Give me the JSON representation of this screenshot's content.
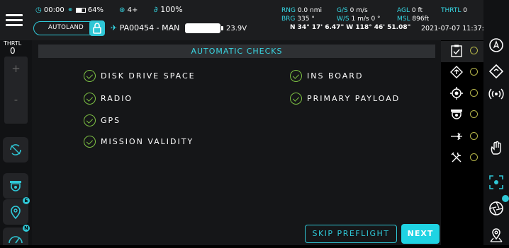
{
  "topbar": {
    "timer": "00:00",
    "battery_pct": "64%",
    "signal": "4+",
    "link": "100%",
    "autoland": "AUTOLAND",
    "aircraft": "PA00454 - MAN",
    "voltage": "23.9V",
    "rng_label": "RNG",
    "rng_val": "0.0 nmi",
    "gs_label": "G/S",
    "gs_val": "0 m/s",
    "agl_label": "AGL",
    "agl_val": "0 ft",
    "thrtl_label": "THRTL",
    "thrtl_val": "0",
    "brg_label": "BRG",
    "brg_val": "335 °",
    "ws_label": "W/S",
    "ws_val": "1 m/s 0 °",
    "msl_label": "MSL",
    "msl_val": "896ft",
    "coords": "N 34° 17' 6.47\" W 118° 46' 51.08\"",
    "datetime": "2021-07-07 11:37:28"
  },
  "left": {
    "thrtl_label": "THRTL",
    "thrtl_val": "0",
    "plus": "+",
    "minus": "-",
    "badge_e": "E",
    "badge_n": "N"
  },
  "main": {
    "title": "AUTOMATIC CHECKS",
    "checks_left": [
      "DISK DRIVE SPACE",
      "RADIO",
      "GPS",
      "MISSION VALIDITY"
    ],
    "checks_right": [
      "INS BOARD",
      "PRIMARY PAYLOAD"
    ],
    "skip_label": "SKIP PREFLIGHT",
    "next_label": "NEXT"
  },
  "right_list": {
    "icons": [
      "checklist-icon",
      "drone-diamond-icon",
      "target-icon",
      "camera-dome-icon",
      "light-burst-icon",
      "tools-icon"
    ]
  },
  "colors": {
    "accent": "#2fc7d6",
    "check_green": "#7dc143",
    "indicator_yellow": "#b6b64a"
  }
}
